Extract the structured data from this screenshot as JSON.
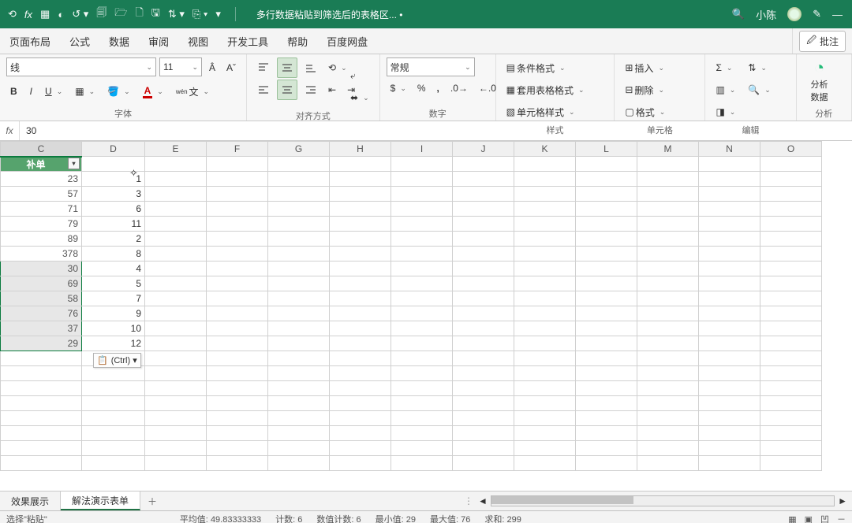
{
  "title": "多行数据粘贴到筛选后的表格区...  •",
  "user": "小陈",
  "tabs": [
    "页面布局",
    "公式",
    "数据",
    "审阅",
    "视图",
    "开发工具",
    "帮助",
    "百度网盘"
  ],
  "pilot_btn": "批注",
  "ribbon": {
    "font_name": "线",
    "font_size": "11",
    "font_group": "字体",
    "align_group": "对齐方式",
    "num_format": "常规",
    "num_group": "数字",
    "styles": {
      "cond": "条件格式",
      "table": "套用表格格式",
      "cell": "单元格样式",
      "cap": "样式"
    },
    "cells": {
      "ins": "插入",
      "del": "删除",
      "fmt": "格式",
      "cap": "单元格"
    },
    "edit_cap": "编辑",
    "analyze": {
      "l1": "分析",
      "l2": "数据",
      "cap": "分析"
    }
  },
  "fx_val": "30",
  "cols": [
    "C",
    "D",
    "E",
    "F",
    "G",
    "H",
    "I",
    "J",
    "K",
    "L",
    "M",
    "N",
    "O"
  ],
  "header_cell": "补单",
  "c_vals": [
    "23",
    "57",
    "71",
    "79",
    "89",
    "378",
    "30",
    "69",
    "58",
    "76",
    "37",
    "29"
  ],
  "d_vals": [
    "1",
    "3",
    "6",
    "11",
    "2",
    "8",
    "4",
    "5",
    "7",
    "9",
    "10",
    "12"
  ],
  "paste_opt": "(Ctrl) ▾",
  "sheets": {
    "s1": "效果展示",
    "s2": "解法演示表单"
  },
  "status": {
    "mode": "选择\"粘贴\"",
    "avg_l": "平均值:",
    "avg_v": "49.83333333",
    "cnt_l": "计数:",
    "cnt_v": "6",
    "ncnt_l": "数值计数:",
    "ncnt_v": "6",
    "min_l": "最小值:",
    "min_v": "29",
    "max_l": "最大值:",
    "max_v": "76",
    "sum_l": "求和:",
    "sum_v": "299"
  }
}
